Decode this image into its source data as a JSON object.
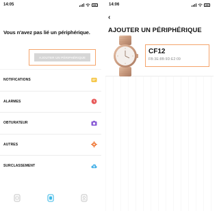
{
  "left_screen": {
    "status_time": "14:05",
    "no_device_message": "Vous n'avez pas lié un périphérique.",
    "add_device_button_label": "AJOUTER UN PÉRIPHÉRIQUE",
    "menu": [
      {
        "label": "NOTIFICATIONS",
        "icon": "message-icon",
        "color": "#f5c542"
      },
      {
        "label": "ALARMES",
        "icon": "clock-icon",
        "color": "#e85a5a"
      },
      {
        "label": "OBTURATEUR",
        "icon": "camera-icon",
        "color": "#8a5cd6"
      },
      {
        "label": "AUTRES",
        "icon": "gear-icon",
        "color": "#ef7b3b"
      },
      {
        "label": "SURCLASSEMENT",
        "icon": "cloud-upload-icon",
        "color": "#4ab2e8"
      }
    ],
    "tabs": [
      {
        "name": "device-tab",
        "active": false
      },
      {
        "name": "watch-tab",
        "active": true
      },
      {
        "name": "profile-tab",
        "active": false
      }
    ],
    "accent_color": "#f4a36a"
  },
  "right_screen": {
    "status_time": "14:06",
    "back_label": "‹",
    "title": "AJOUTER UN PÉRIPHÉRIQUE",
    "device": {
      "name": "CF12",
      "mac": "FB:3E:8B:9D:E2:09",
      "image": "rose-gold-smartwatch"
    }
  }
}
